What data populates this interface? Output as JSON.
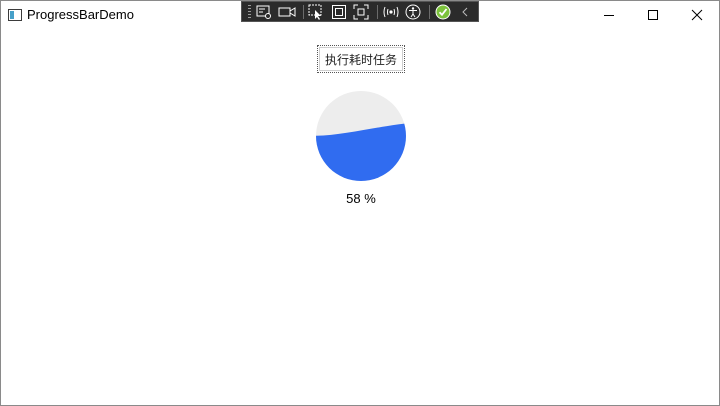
{
  "window": {
    "title": "ProgressBarDemo"
  },
  "main": {
    "task_button_label": "执行耗时任务",
    "progress": {
      "value": 58,
      "label": "58 %"
    }
  },
  "colors": {
    "progress_fill": "#306cf0",
    "progress_track": "#ededed",
    "toolbar_bg": "#2b2b2b",
    "check_green": "#7cc23c"
  }
}
